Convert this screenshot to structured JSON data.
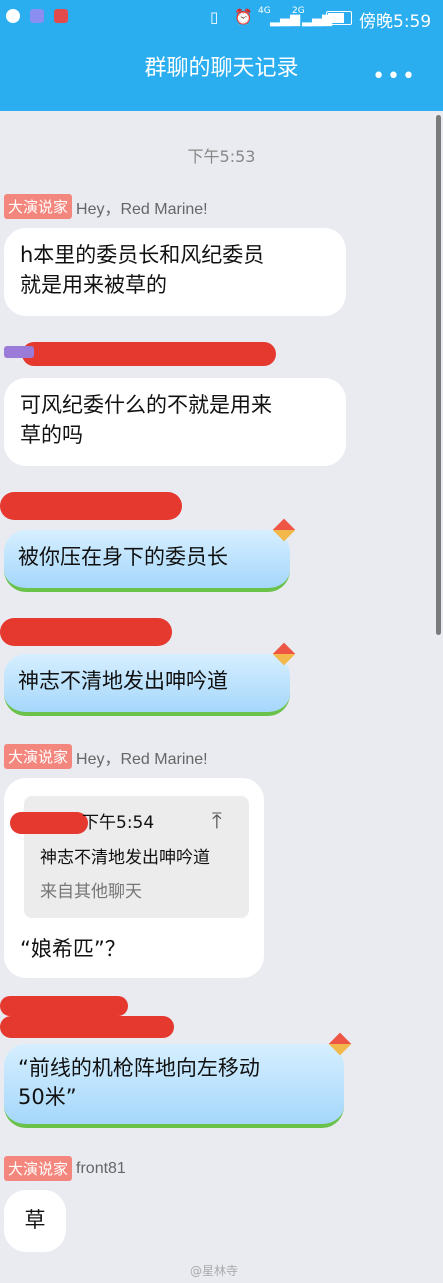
{
  "status_bar": {
    "network_1": "4G",
    "network_2": "2G",
    "time": "傍晚5:59"
  },
  "header": {
    "title": "群聊的聊天记录",
    "more": "•••"
  },
  "messages": {
    "timestamp_1": "下午5:53",
    "m1": {
      "tag": "大演说家",
      "nick": "Hey，Red Marine!",
      "text_1": "h本里的委员长和风纪委员",
      "text_2": "就是用来被草的"
    },
    "m2": {
      "text_1": "可风纪委什么的不就是用来",
      "text_2": "草的吗"
    },
    "m3": {
      "text": "被你压在身下的委员长"
    },
    "m4": {
      "text": "神志不清地发出呻吟道"
    },
    "m5": {
      "tag": "大演说家",
      "nick": "Hey，Red Marine!",
      "quote_time": "下午5:54",
      "quote_text": "神志不清地发出呻吟道",
      "quote_source": "来自其他聊天",
      "text": "“娘希匹”？"
    },
    "m6": {
      "text_1": "“前线的机枪阵地向左移动",
      "text_2": "50米”"
    },
    "m7": {
      "tag": "大演说家",
      "nick": "front81",
      "text": "草"
    }
  },
  "watermark": "@星林寺"
}
